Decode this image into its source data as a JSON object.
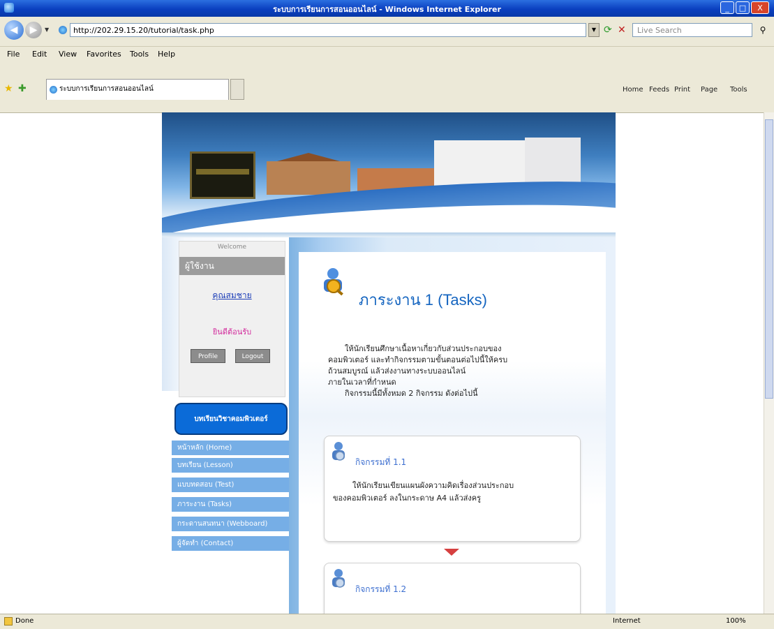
{
  "window": {
    "title": "ระบบการเรียนการสอนออนไลน์ - Windows Internet Explorer",
    "controls": [
      "_",
      "□",
      "X"
    ]
  },
  "address_bar": {
    "url": "http://202.29.15.20/tutorial/task.php",
    "search_placeholder": "Live Search"
  },
  "menu": [
    "File",
    "Edit",
    "View",
    "Favorites",
    "Tools",
    "Help"
  ],
  "tab": {
    "title": "ระบบการเรียนการสอนออนไลน์"
  },
  "command_bar": [
    "Home",
    "Feeds",
    "Print",
    "Page",
    "Tools"
  ],
  "sidebar": {
    "member_caption": "Welcome",
    "member_header": "ผู้ใช้งาน",
    "member_name": "คุณสมชาย",
    "member_welcome": "ยินดีต้อนรับ",
    "buttons": [
      "Profile",
      "Logout"
    ],
    "course_button": "บทเรียนวิชาคอมพิวเตอร์",
    "nav_items": [
      "หน้าหลัก (Home)",
      "บทเรียน (Lesson)",
      "แบบทดสอบ (Test)",
      "ภาระงาน (Tasks)",
      "กระดานสนทนา (Webboard)",
      "ผู้จัดทำ (Contact)"
    ]
  },
  "main": {
    "title": "ภาระงาน 1 (Tasks)",
    "intro_lines": [
      "ให้นักเรียนศึกษาเนื้อหาเกี่ยวกับส่วนประกอบของ",
      "คอมพิวเตอร์ และทำกิจกรรมตามขั้นตอนต่อไปนี้ให้ครบ",
      "ถ้วนสมบูรณ์ แล้วส่งงานทางระบบออนไลน์",
      "ภายในเวลาที่กำหนด",
      "กิจกรรมนี้มีทั้งหมด 2 กิจกรรม ดังต่อไปนี้"
    ],
    "activities": [
      {
        "title": "กิจกรรมที่ 1.1",
        "body_lines": [
          "ให้นักเรียนเขียนแผนผังความคิดเรื่องส่วนประกอบ",
          "ของคอมพิวเตอร์ ลงในกระดาษ A4 แล้วส่งครู"
        ]
      },
      {
        "title": "กิจกรรมที่ 1.2",
        "body_lines": []
      }
    ]
  },
  "status_bar": {
    "left": "Done",
    "zone": "Internet",
    "zoom": "100%"
  }
}
